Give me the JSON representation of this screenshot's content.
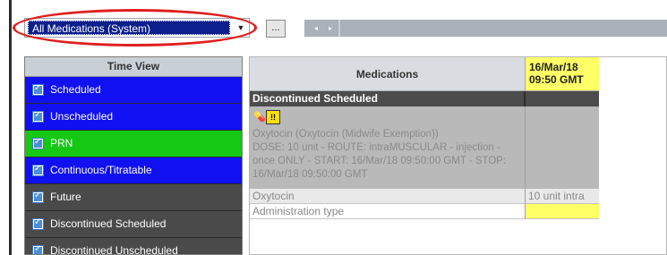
{
  "toolbar": {
    "filter_value": "All Medications (System)",
    "ellipsis_label": "...",
    "scroll_left": "◂",
    "scroll_right": "▸"
  },
  "time_view": {
    "header": "Time View",
    "items": [
      {
        "label": "Scheduled",
        "color": "#1010f0"
      },
      {
        "label": "Unscheduled",
        "color": "#1010f0"
      },
      {
        "label": "PRN",
        "color": "#14c814"
      },
      {
        "label": "Continuous/Titratable",
        "color": "#1010f0"
      },
      {
        "label": "Future",
        "color": "#4a4a4a"
      },
      {
        "label": "Discontinued Scheduled",
        "color": "#4a4a4a"
      },
      {
        "label": "Discontinued Unscheduled",
        "color": "#4a4a4a"
      }
    ]
  },
  "grid": {
    "med_header": "Medications",
    "date_header": "16/Mar/18\n09:50 GMT",
    "date_line1": "16/Mar/18",
    "date_line2": "09:50 GMT",
    "section": "Discontinued Scheduled",
    "order": {
      "icons": [
        "pill-icon",
        "warning-icon"
      ],
      "name": "Oxytocin (Oxytocin (Midwife Exemption))",
      "detail": "DOSE: 10 unit - ROUTE: intraMUSCULAR - injection - once ONLY - START: 16/Mar/18 09:50:00 GMT - STOP: 16/Mar/18 09:50:00 GMT"
    },
    "rows": [
      {
        "label": "Oxytocin",
        "value": "10 unit intra"
      },
      {
        "label": "Administration type",
        "value": ""
      }
    ]
  },
  "colors": {
    "selection_blue": "#0c1f8c",
    "annotation_red": "#e01e1e",
    "highlight_yellow": "#ffff66"
  }
}
